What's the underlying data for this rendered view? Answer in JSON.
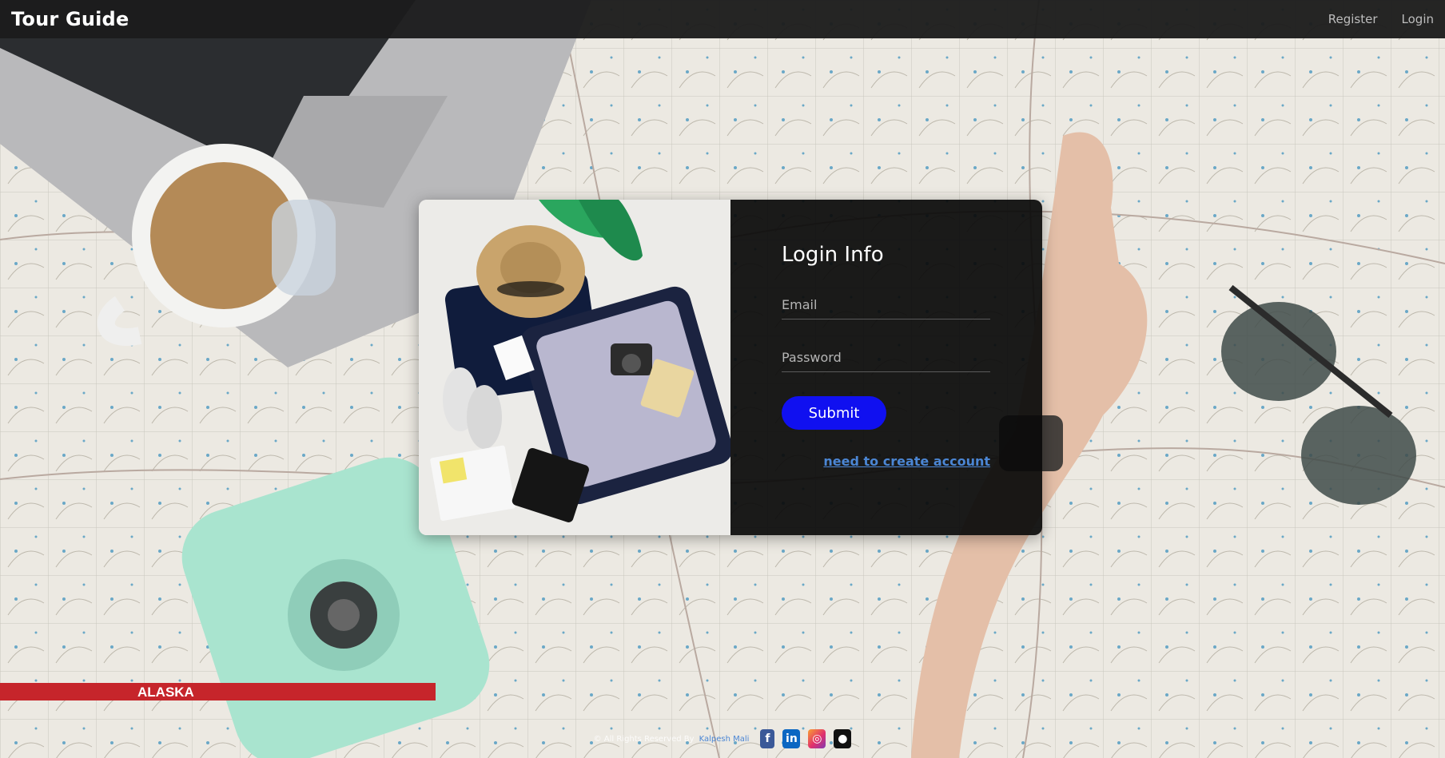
{
  "navbar": {
    "brand": "Tour Guide",
    "links": [
      {
        "label": "Register"
      },
      {
        "label": "Login"
      }
    ]
  },
  "login": {
    "title": "Login Info",
    "email": {
      "placeholder": "Email",
      "value": ""
    },
    "password": {
      "placeholder": "Password",
      "value": ""
    },
    "submit_label": "Submit",
    "create_account_link": "need to create account"
  },
  "footer": {
    "text": "© All Rights Reserved By",
    "author": "Kalpesh Mali",
    "social": [
      {
        "icon": "facebook-icon",
        "glyph": "f"
      },
      {
        "icon": "linkedin-icon",
        "glyph": "in"
      },
      {
        "icon": "instagram-icon",
        "glyph": "◎"
      },
      {
        "icon": "github-icon",
        "glyph": "●"
      }
    ]
  },
  "colors": {
    "navbar_bg": "#1c1c1c",
    "form_bg": "#0a0a0a",
    "submit_bg": "#1010f0",
    "link": "#4b86d4"
  }
}
